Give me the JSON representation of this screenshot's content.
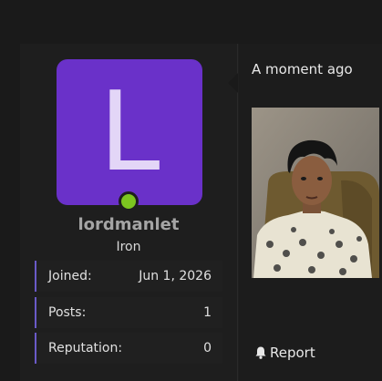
{
  "user": {
    "avatar_letter": "L",
    "avatar_color": "#6a31c9",
    "online_color": "#7cc520",
    "username": "lordmanlet",
    "rank": "Iron"
  },
  "stats": [
    {
      "label": "Joined:",
      "value": "Jun 1, 2026"
    },
    {
      "label": "Posts:",
      "value": "1"
    },
    {
      "label": "Reputation:",
      "value": "0"
    }
  ],
  "post": {
    "timestamp": "A moment ago",
    "image_icon": "photo-of-person",
    "report_icon": "bell-icon",
    "report_label": "Report"
  }
}
